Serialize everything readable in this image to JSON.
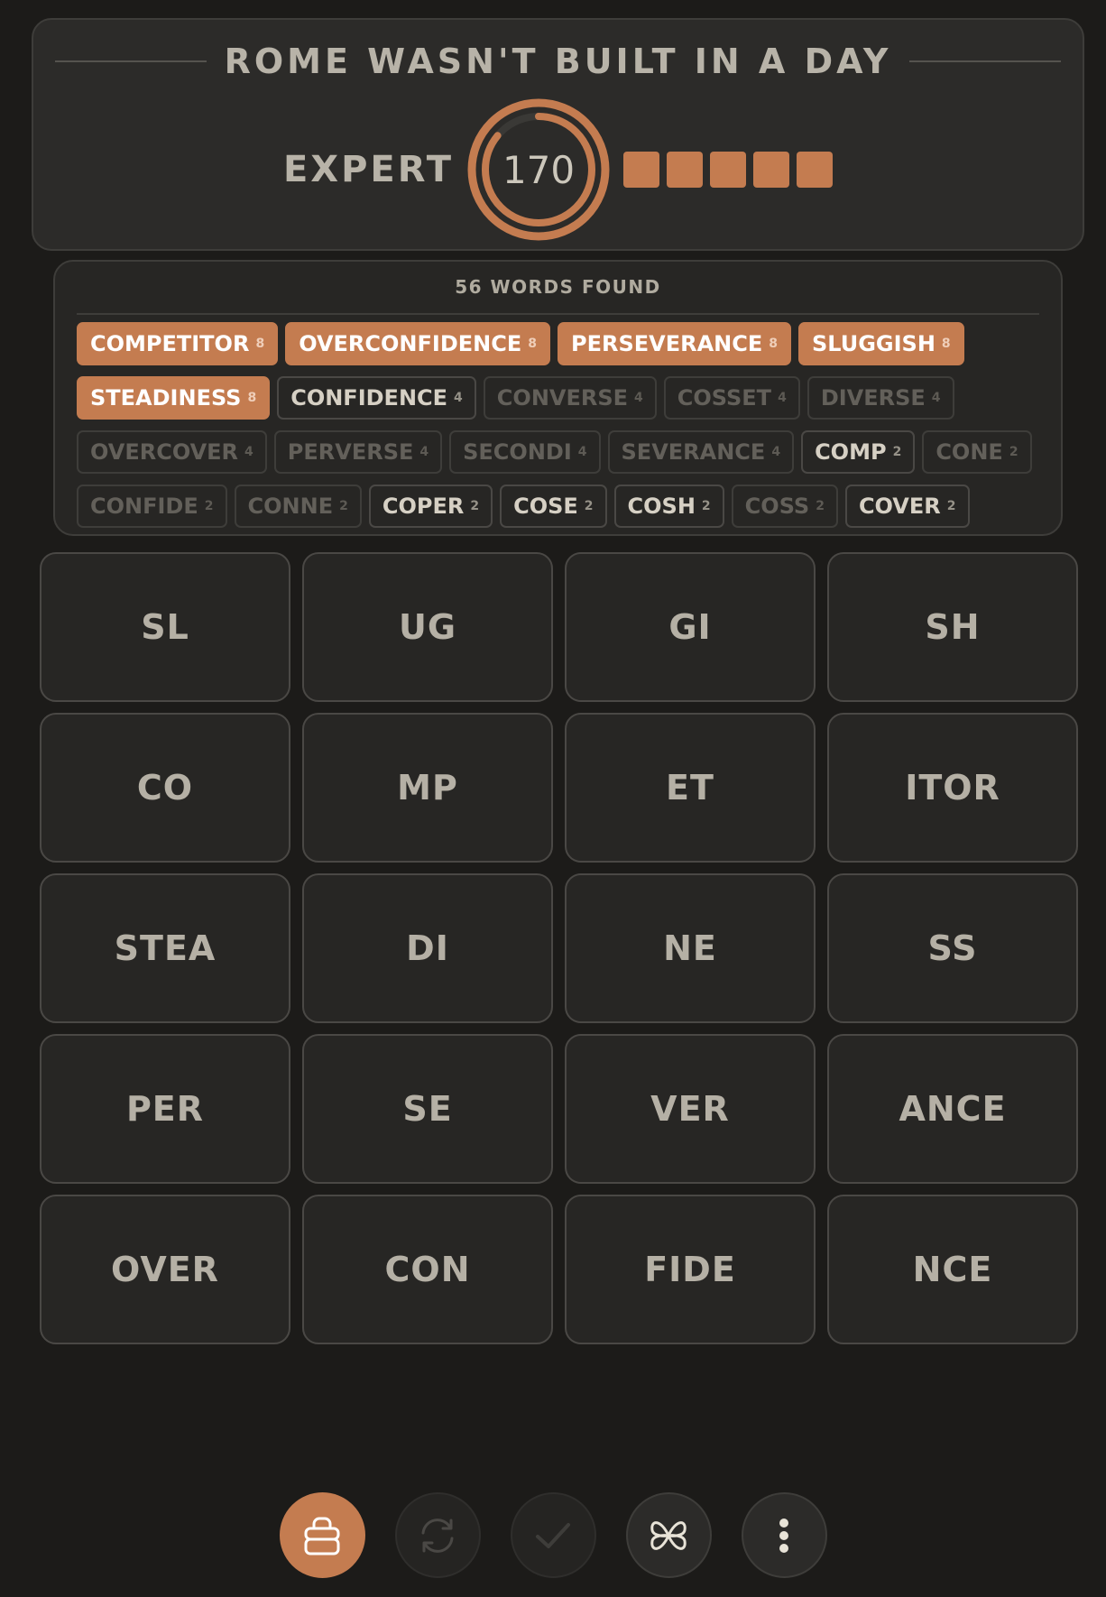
{
  "header": {
    "title": "ROME WASN'T BUILT IN A DAY",
    "rank": "EXPERT",
    "score": "170",
    "progress_blocks_filled": 5,
    "progress_blocks_total": 5,
    "ring_progress": 0.86
  },
  "found": {
    "title": "56 WORDS FOUND",
    "words": [
      {
        "word": "COMPETITOR",
        "points": "8",
        "state": "full"
      },
      {
        "word": "OVERCONFIDENCE",
        "points": "8",
        "state": "full"
      },
      {
        "word": "PERSEVERANCE",
        "points": "8",
        "state": "full"
      },
      {
        "word": "SLUGGISH",
        "points": "8",
        "state": "full"
      },
      {
        "word": "STEADINESS",
        "points": "8",
        "state": "full"
      },
      {
        "word": "CONFIDENCE",
        "points": "4",
        "state": "partial"
      },
      {
        "word": "CONVERSE",
        "points": "4",
        "state": "dim"
      },
      {
        "word": "COSSET",
        "points": "4",
        "state": "dim"
      },
      {
        "word": "DIVERSE",
        "points": "4",
        "state": "dim"
      },
      {
        "word": "OVERCOVER",
        "points": "4",
        "state": "dim"
      },
      {
        "word": "PERVERSE",
        "points": "4",
        "state": "dim"
      },
      {
        "word": "SECONDI",
        "points": "4",
        "state": "dim"
      },
      {
        "word": "SEVERANCE",
        "points": "4",
        "state": "dim"
      },
      {
        "word": "COMP",
        "points": "2",
        "state": "partial"
      },
      {
        "word": "CONE",
        "points": "2",
        "state": "dim"
      },
      {
        "word": "CONFIDE",
        "points": "2",
        "state": "dim"
      },
      {
        "word": "CONNE",
        "points": "2",
        "state": "dim"
      },
      {
        "word": "COPER",
        "points": "2",
        "state": "partial"
      },
      {
        "word": "COSE",
        "points": "2",
        "state": "partial"
      },
      {
        "word": "COSH",
        "points": "2",
        "state": "partial"
      },
      {
        "word": "COSS",
        "points": "2",
        "state": "dim"
      },
      {
        "word": "COVER",
        "points": "2",
        "state": "partial"
      }
    ]
  },
  "tiles": [
    "SL",
    "UG",
    "GI",
    "SH",
    "CO",
    "MP",
    "ET",
    "ITOR",
    "STEA",
    "DI",
    "NE",
    "SS",
    "PER",
    "SE",
    "VER",
    "ANCE",
    "OVER",
    "CON",
    "FIDE",
    "NCE"
  ],
  "toolbar": {
    "buttons": [
      {
        "icon": "cup-icon",
        "state": "primary"
      },
      {
        "icon": "shuffle-icon",
        "state": "disabled"
      },
      {
        "icon": "check-icon",
        "state": "disabled"
      },
      {
        "icon": "flower-icon",
        "state": "normal"
      },
      {
        "icon": "more-icon",
        "state": "normal"
      }
    ]
  },
  "colors": {
    "accent": "#c47c50",
    "background": "#1c1b19",
    "card": "#2c2b29",
    "tile": "#272624"
  }
}
